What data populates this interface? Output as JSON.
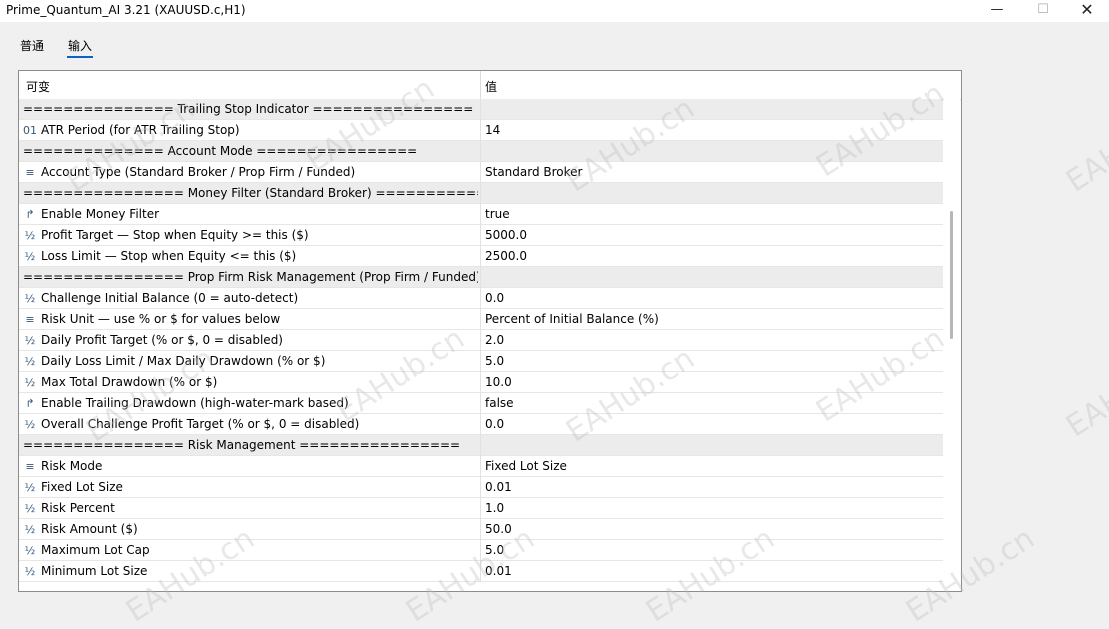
{
  "window": {
    "title": "Prime_Quantum_AI 3.21 (XAUUSD.c,H1)",
    "min_label": "—",
    "max_label": "☐",
    "close_label": "✕"
  },
  "tabs": [
    {
      "label": "普通"
    },
    {
      "label": "输入"
    }
  ],
  "table": {
    "col_variable": "可变",
    "col_value": "值",
    "rows": [
      {
        "kind": "section",
        "name": "=============== Trailing Stop Indicator ================",
        "value": ""
      },
      {
        "kind": "num",
        "icon": "01",
        "name": "ATR Period (for ATR Trailing Stop)",
        "value": "14"
      },
      {
        "kind": "section",
        "name": "============== Account Mode ================",
        "value": ""
      },
      {
        "kind": "list",
        "icon": "≡",
        "name": "Account Type (Standard Broker / Prop Firm / Funded)",
        "value": "Standard Broker"
      },
      {
        "kind": "section",
        "name": "================ Money Filter  (Standard Broker) ==============...",
        "value": ""
      },
      {
        "kind": "bool",
        "icon": "↱",
        "name": "Enable Money Filter",
        "value": "true"
      },
      {
        "kind": "frac",
        "icon": "½",
        "name": "Profit Target — Stop when Equity >= this ($)",
        "value": "5000.0"
      },
      {
        "kind": "frac",
        "icon": "½",
        "name": "Loss Limit   — Stop when Equity <= this ($)",
        "value": "2500.0"
      },
      {
        "kind": "section",
        "name": "================ Prop Firm Risk Management  (Prop Firm / Funded)",
        "value": ""
      },
      {
        "kind": "frac",
        "icon": "½",
        "name": "Challenge Initial Balance (0 = auto-detect)",
        "value": "0.0"
      },
      {
        "kind": "list",
        "icon": "≡",
        "name": "Risk Unit — use % or $ for values below",
        "value": "Percent of Initial Balance (%)"
      },
      {
        "kind": "frac",
        "icon": "½",
        "name": "Daily Profit Target      (% or $, 0 = disabled)",
        "value": "2.0"
      },
      {
        "kind": "frac",
        "icon": "½",
        "name": "Daily Loss Limit / Max Daily Drawdown (% or $)",
        "value": "5.0"
      },
      {
        "kind": "frac",
        "icon": "½",
        "name": "Max Total Drawdown        (% or $)",
        "value": "10.0"
      },
      {
        "kind": "bool",
        "icon": "↱",
        "name": "Enable Trailing Drawdown (high-water-mark based)",
        "value": "false"
      },
      {
        "kind": "frac",
        "icon": "½",
        "name": "Overall Challenge Profit Target (% or $, 0 = disabled)",
        "value": "0.0"
      },
      {
        "kind": "section",
        "name": "================ Risk Management ================",
        "value": ""
      },
      {
        "kind": "list",
        "icon": "≡",
        "name": "Risk Mode",
        "value": "Fixed Lot Size"
      },
      {
        "kind": "frac",
        "icon": "½",
        "name": "Fixed Lot Size",
        "value": "0.01"
      },
      {
        "kind": "frac",
        "icon": "½",
        "name": "Risk Percent",
        "value": "1.0"
      },
      {
        "kind": "frac",
        "icon": "½",
        "name": "Risk Amount ($)",
        "value": "50.0"
      },
      {
        "kind": "frac",
        "icon": "½",
        "name": "Maximum Lot Cap",
        "value": "5.0"
      },
      {
        "kind": "frac",
        "icon": "½",
        "name": "Minimum Lot Size",
        "value": "0.01"
      }
    ]
  },
  "watermark": "EAHub.cn"
}
